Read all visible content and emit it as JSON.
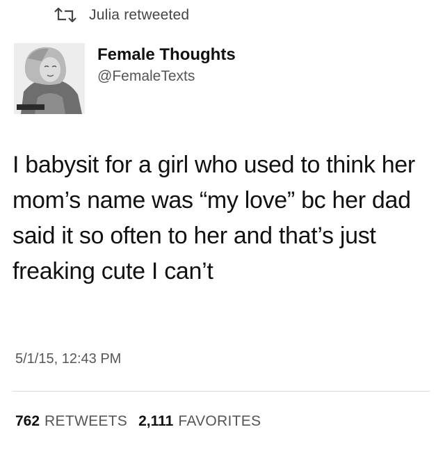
{
  "retweet": {
    "icon": "retweet-icon",
    "text": "Julia retweeted"
  },
  "author": {
    "display_name": "Female Thoughts",
    "handle": "@FemaleTexts",
    "avatar": "profile-photo"
  },
  "tweet": {
    "text": "I babysit for a girl who used to think her mom’s name was “my love” bc her dad said it so often to her and that’s just freaking cute I can’t",
    "timestamp": "5/1/15, 12:43 PM"
  },
  "stats": {
    "retweets_count": "762",
    "retweets_label": "RETWEETS",
    "favorites_count": "2,111",
    "favorites_label": "FAVORITES"
  },
  "colors": {
    "text_primary": "#111111",
    "text_secondary": "#555555",
    "divider": "#d9d9d9",
    "background": "#ffffff"
  }
}
